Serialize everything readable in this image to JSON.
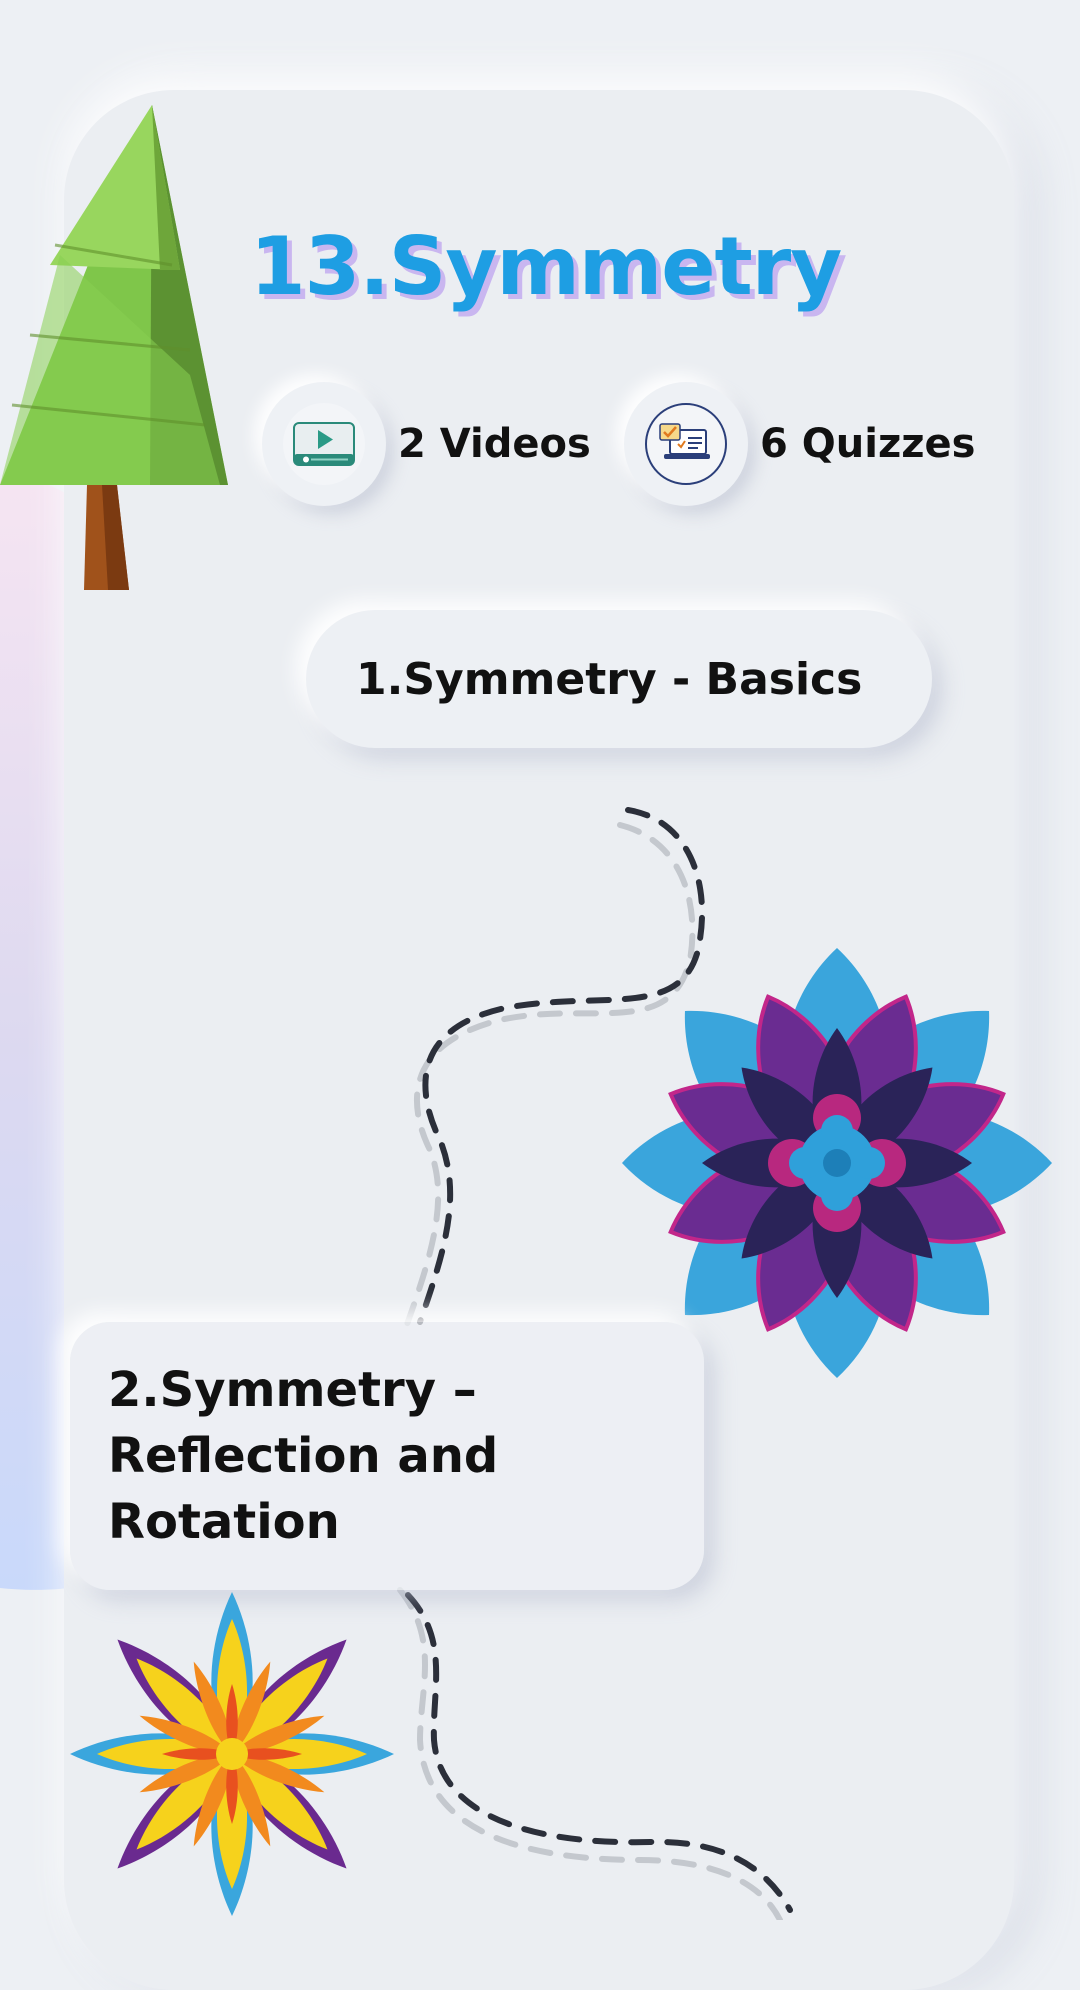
{
  "page": {
    "title": "13.Symmetry",
    "colors": {
      "title": "#1e9ee3",
      "title_shadow": "#c9b6f0",
      "background": "#edf0f4"
    }
  },
  "stats": [
    {
      "label": "2 Videos",
      "icon": "video-player-icon"
    },
    {
      "label": "6 Quizzes",
      "icon": "quiz-laptop-icon"
    }
  ],
  "lessons": [
    {
      "label": "1.Symmetry - Basics"
    },
    {
      "label": "2.Symmetry – Reflection and Rotation"
    }
  ],
  "decorations": [
    "pine-tree-icon",
    "blue-purple-mandala-icon",
    "orange-star-mandala-icon",
    "dashed-path"
  ]
}
